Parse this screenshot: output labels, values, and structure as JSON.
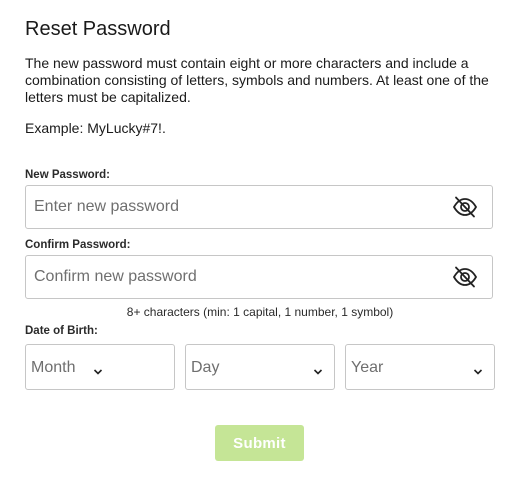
{
  "header": {
    "title": "Reset Password"
  },
  "instructions": {
    "description": "The new password must contain eight or more characters and include a combination consisting of letters, symbols and numbers. At least one of the letters must be capitalized.",
    "example": "Example: MyLucky#7!."
  },
  "new_password": {
    "label": "New Password:",
    "value": "",
    "placeholder": "Enter new password",
    "toggle_icon": "eye-slash-icon"
  },
  "confirm_password": {
    "label": "Confirm Password:",
    "value": "",
    "placeholder": "Confirm new password",
    "toggle_icon": "eye-slash-icon"
  },
  "password_hint": "8+ characters (min: 1 capital, 1 number, 1 symbol)",
  "date_of_birth": {
    "label": "Date of Birth:",
    "month": "Month",
    "day": "Day",
    "year": "Year",
    "chevron_icon": "chevron-down-icon"
  },
  "submit": {
    "label": "Submit",
    "color": "#c5e596"
  },
  "colors": {
    "border": "#c6c6c6",
    "text": "#1a1a1a",
    "placeholder": "#6f6f6f"
  }
}
